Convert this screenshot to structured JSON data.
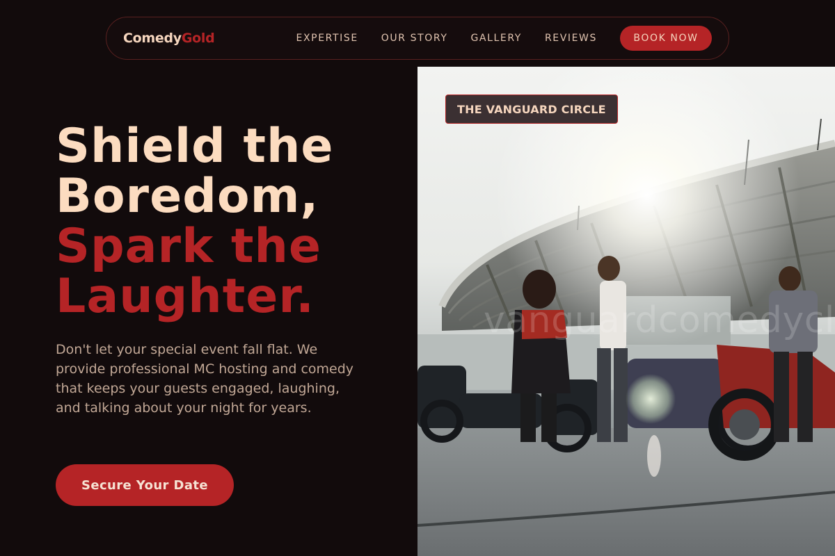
{
  "brand": {
    "name_main": "Comedy",
    "name_accent": "Gold"
  },
  "nav": {
    "links": [
      "EXPERTISE",
      "OUR STORY",
      "GALLERY",
      "REVIEWS"
    ],
    "book_label": "BOOK NOW"
  },
  "hero": {
    "headline_line1": "Shield the",
    "headline_line2": "Boredom,",
    "headline_line3": "Spark the",
    "headline_line4": "Laughter.",
    "subtext": "Don't let your special event fall flat. We provide professional MC hosting and comedy that keeps your guests engaged, laughing, and talking about your night for years.",
    "cta_label": "Secure Your Date"
  },
  "image": {
    "badge": "THE VANGUARD CIRCLE",
    "watermark": "vanguardcomedyclub"
  },
  "colors": {
    "background": "#120b0c",
    "accent_red": "#b52426",
    "cream": "#fcdcc0",
    "muted_text": "#c2a896"
  }
}
